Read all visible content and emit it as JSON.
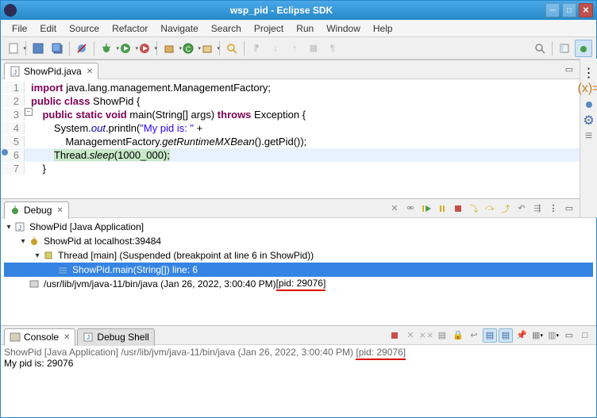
{
  "window": {
    "title": "wsp_pid - Eclipse SDK"
  },
  "menu": [
    "File",
    "Edit",
    "Source",
    "Refactor",
    "Navigate",
    "Search",
    "Project",
    "Run",
    "Window",
    "Help"
  ],
  "editor": {
    "tab_title": "ShowPid.java",
    "lines": [
      {
        "n": "1",
        "pre": "",
        "tokens": [
          [
            "kw",
            "import"
          ],
          [
            "",
            " java.lang.management.ManagementFactory;"
          ]
        ]
      },
      {
        "n": "2",
        "pre": "",
        "tokens": [
          [
            "kw",
            "public class"
          ],
          [
            "",
            " ShowPid {"
          ]
        ]
      },
      {
        "n": "3",
        "pre": "    ",
        "tokens": [
          [
            "kw",
            "public static void"
          ],
          [
            "",
            " main(String[] args) "
          ],
          [
            "kw",
            "throws"
          ],
          [
            "",
            " Exception {"
          ]
        ]
      },
      {
        "n": "4",
        "pre": "        ",
        "tokens": [
          [
            "",
            "System."
          ],
          [
            "fld",
            "out"
          ],
          [
            "",
            ".println("
          ],
          [
            "str",
            "\"My pid is: \""
          ],
          [
            "",
            " +"
          ]
        ]
      },
      {
        "n": "5",
        "pre": "            ",
        "tokens": [
          [
            "",
            "ManagementFactory."
          ],
          [
            "mtd",
            "getRuntimeMXBean"
          ],
          [
            "",
            "().getPid());"
          ]
        ]
      },
      {
        "n": "6",
        "pre": "        ",
        "exec": true,
        "tokens": [
          [
            "",
            "Thread."
          ],
          [
            "mtd",
            "sleep"
          ],
          [
            "",
            "(1000_000);"
          ]
        ]
      },
      {
        "n": "7",
        "pre": "    ",
        "tokens": [
          [
            "",
            "}"
          ]
        ]
      }
    ]
  },
  "debug": {
    "tab": "Debug",
    "rows": [
      {
        "ind": 0,
        "tw": "▾",
        "ico": "J",
        "text": "ShowPid [Java Application]"
      },
      {
        "ind": 1,
        "tw": "▾",
        "ico": "bug",
        "text": "ShowPid at localhost:39484"
      },
      {
        "ind": 2,
        "tw": "▾",
        "ico": "thr",
        "text": "Thread [main] (Suspended (breakpoint at line 6 in ShowPid))"
      },
      {
        "ind": 3,
        "tw": "",
        "ico": "frm",
        "sel": true,
        "text": "ShowPid.main(String[]) line: 6"
      },
      {
        "ind": 1,
        "tw": "",
        "ico": "prc",
        "text": "/usr/lib/jvm/java-11/bin/java (Jan 26, 2022, 3:00:40 PM) ",
        "pid": "[pid: 29076]"
      }
    ]
  },
  "console": {
    "tab1": "Console",
    "tab2": "Debug Shell",
    "header_a": "ShowPid [Java Application] /usr/lib/jvm/java-11/bin/java  (Jan 26, 2022, 3:00:40 PM) ",
    "header_pid": "[pid: 29076]",
    "output": "My pid is: 29076"
  }
}
